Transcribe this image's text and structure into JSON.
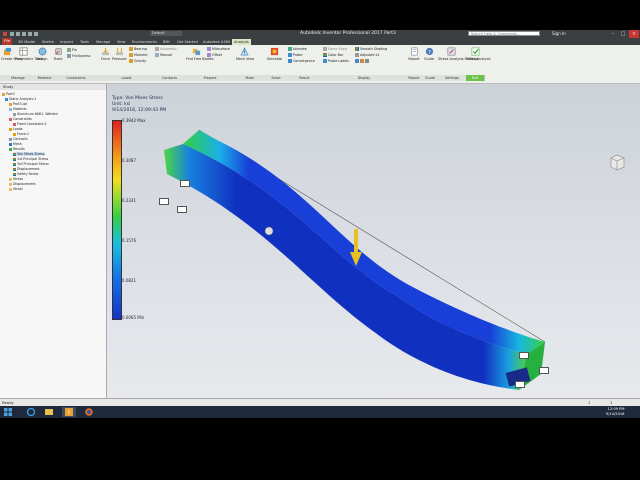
{
  "app": {
    "title": "Autodesk Inventor Professional 2017   Part3",
    "search_placeholder": "Search Help & Commands...",
    "sign_in": "Sign In",
    "part_tab": "Default"
  },
  "tabs": [
    {
      "label": "File"
    },
    {
      "label": "3D Model"
    },
    {
      "label": "Sketch"
    },
    {
      "label": "Inspect"
    },
    {
      "label": "Tools"
    },
    {
      "label": "Manage"
    },
    {
      "label": "View"
    },
    {
      "label": "Environments"
    },
    {
      "label": "BIM"
    },
    {
      "label": "Get Started"
    },
    {
      "label": "Autodesk A360"
    },
    {
      "label": "Analysis"
    }
  ],
  "ribbon": {
    "create_study": "Create Study",
    "parametric_table": "Parametric Table",
    "assign": "Assign",
    "fixed": "Fixed",
    "pin": "Pin",
    "frictionless": "Frictionless",
    "force": "Force",
    "pressure": "Pressure",
    "bearing": "Bearing",
    "moment": "Moment",
    "gravity": "Gravity",
    "automatic": "Automatic",
    "manual": "Manual",
    "find_free_bodies": "Find Free Bodies",
    "midsurface": "Midsurface",
    "offset": "Offset",
    "mesh_view": "Mesh View",
    "simulate": "Simulate",
    "animate": "Animate",
    "probe": "Probe",
    "convergence": "Convergence",
    "same_scale": "Same Scale",
    "color_bar": "Color Bar",
    "probe_labels": "Probe Labels",
    "smooth_shading": "Smooth Shading",
    "adjusted": "Adjusted x1",
    "report": "Report",
    "guide": "Guide",
    "stress_analysis_settings": "Stress Analysis Settings",
    "finish_analysis": "Finish Analysis",
    "groups": [
      "Manage",
      "Material",
      "Constraints",
      "Loads",
      "Contacts",
      "Prepare",
      "Mesh",
      "Solve",
      "Result",
      "Display",
      "Report",
      "Guide",
      "Settings",
      "Exit"
    ]
  },
  "browser": {
    "header": "Study",
    "items": [
      {
        "label": "Part3"
      },
      {
        "label": "Static Analysis:1"
      },
      {
        "label": "Part3.ipt"
      },
      {
        "label": "Material"
      },
      {
        "label": "Aluminum 6061, Welded"
      },
      {
        "label": "Constraints"
      },
      {
        "label": "Fixed Constraint:1"
      },
      {
        "label": "Loads"
      },
      {
        "label": "Force:1"
      },
      {
        "label": "Contacts"
      },
      {
        "label": "Mesh"
      },
      {
        "label": "Results"
      },
      {
        "label": "Von Mises Stress"
      },
      {
        "label": "1st Principal Stress"
      },
      {
        "label": "3rd Principal Stress"
      },
      {
        "label": "Displacement"
      },
      {
        "label": "Safety Factor"
      },
      {
        "label": "Stress"
      },
      {
        "label": "Displacement"
      },
      {
        "label": "Strain"
      }
    ]
  },
  "viewport": {
    "type_line": "Type: Von Mises Stress",
    "unit_line": "Unit: ksi",
    "date_line": "9/14/2016, 12:09:43 PM",
    "scale_labels": [
      "0.3942 Max",
      "0.3087",
      "0.2331",
      "0.1576",
      "0.0821",
      "0.0065 Min"
    ],
    "scale_values": [
      0.3942,
      0.3087,
      0.2331,
      0.1576,
      0.0821,
      0.0065
    ]
  },
  "status": {
    "text": "Ready",
    "left_num": "1",
    "right_num": "1"
  },
  "taskbar": {
    "time": "12:09 PM",
    "date": "9/14/2016"
  }
}
